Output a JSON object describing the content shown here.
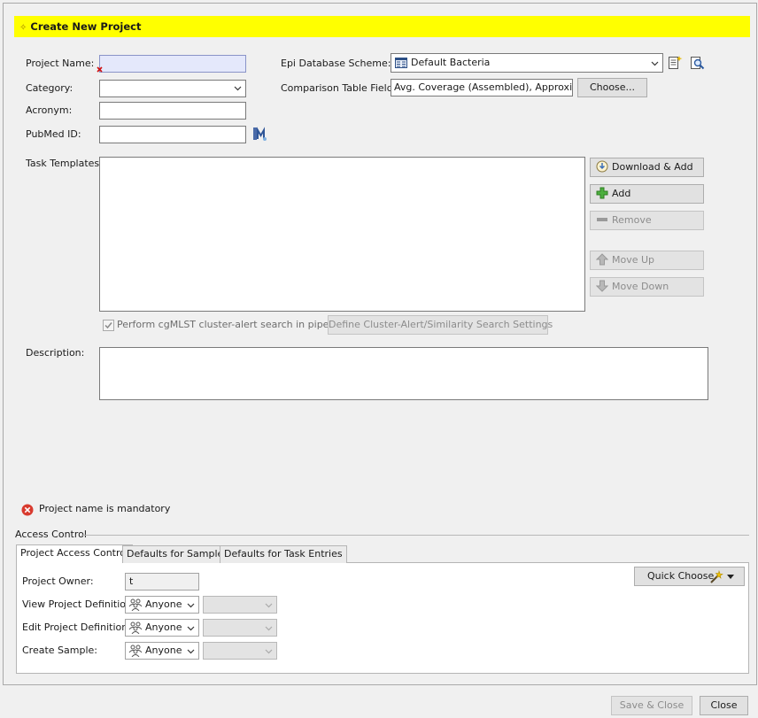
{
  "dialog": {
    "title": "Create New Project"
  },
  "form": {
    "project_name_label": "Project Name:",
    "category_label": "Category:",
    "acronym_label": "Acronym:",
    "pubmed_label": "PubMed ID:",
    "epi_scheme_label": "Epi Database Scheme:",
    "epi_scheme_value": "Default Bacteria",
    "comparison_fields_label": "Comparison Table Fields:",
    "comparison_fields_value": "Avg. Coverage (Assembled), Approximated",
    "choose_button": "Choose...",
    "task_templates_label": "Task Templates:",
    "description_label": "Description:"
  },
  "task_buttons": {
    "download_add": "Download & Add",
    "add": "Add",
    "remove": "Remove",
    "move_up": "Move Up",
    "move_down": "Move Down"
  },
  "cluster": {
    "checkbox_label": "Perform cgMLST cluster-alert search in pipelines",
    "define_button": "Define Cluster-Alert/Similarity Search Settings"
  },
  "validation": {
    "message": "Project name is mandatory"
  },
  "access_control": {
    "section_label": "Access Control",
    "tabs": [
      {
        "label": "Project Access Control"
      },
      {
        "label": "Defaults for Samples"
      },
      {
        "label": "Defaults for Task Entries"
      }
    ],
    "quick_choose": "Quick Choose",
    "owner_label": "Project Owner:",
    "owner_value": "t",
    "view_label": "View Project Definition:",
    "view_value": "Anyone",
    "edit_label": "Edit Project Definition:",
    "edit_value": "Anyone",
    "create_label": "Create Sample:",
    "create_value": "Anyone"
  },
  "footer": {
    "save_close": "Save & Close",
    "close": "Close"
  }
}
